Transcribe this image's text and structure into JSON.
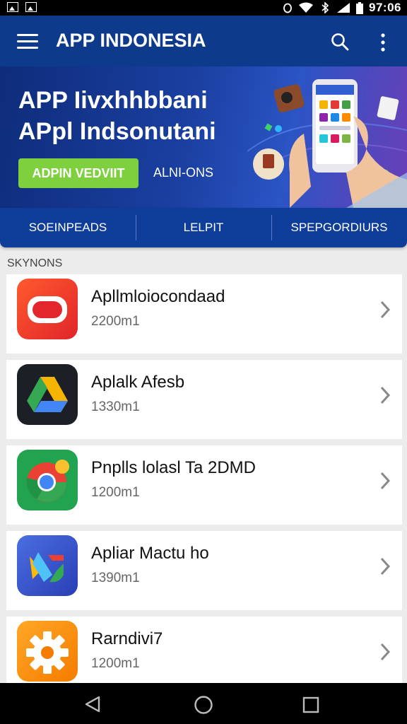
{
  "status_bar": {
    "time": "97:06",
    "icons": [
      "image-icon",
      "image-icon",
      "alarm-icon",
      "wifi-icon",
      "bluetooth-icon",
      "signal-icon",
      "battery-icon"
    ]
  },
  "app_bar": {
    "title": "APP INDONESIA",
    "icons": [
      "menu-icon",
      "search-icon",
      "more-vert-icon"
    ]
  },
  "banner": {
    "headline_line1": "APP Iivxhhbbani",
    "headline_line2": "APpl Indsonutani",
    "cta_label": "ADPIN VEDVIIT",
    "secondary_label": "ALNI-ONS",
    "cta_color": "#7ed03f"
  },
  "tabs": [
    {
      "label": "SOEINPEADS"
    },
    {
      "label": "LELPIT"
    },
    {
      "label": "SPEPGORDIURS"
    }
  ],
  "section": {
    "label": "SKYNONS"
  },
  "apps": [
    {
      "name": "Apllmloiocondaad",
      "size": "2200m1",
      "icon": "youtube-style-icon"
    },
    {
      "name": "Aplalk Afesb",
      "size": "1330m1",
      "icon": "drive-style-icon"
    },
    {
      "name": "Pnplls lolasl Ta 2DMD",
      "size": "1200m1",
      "icon": "chrome-style-icon"
    },
    {
      "name": "Apliar Mactu ho",
      "size": "1390m1",
      "icon": "google-style-icon"
    },
    {
      "name": "Rarndivi7",
      "size": "1200m1",
      "icon": "settings-gear-icon"
    }
  ],
  "colors": {
    "app_bar": "#0d3a8a",
    "tab_bar": "#0f3e9a",
    "background": "#ececec"
  }
}
